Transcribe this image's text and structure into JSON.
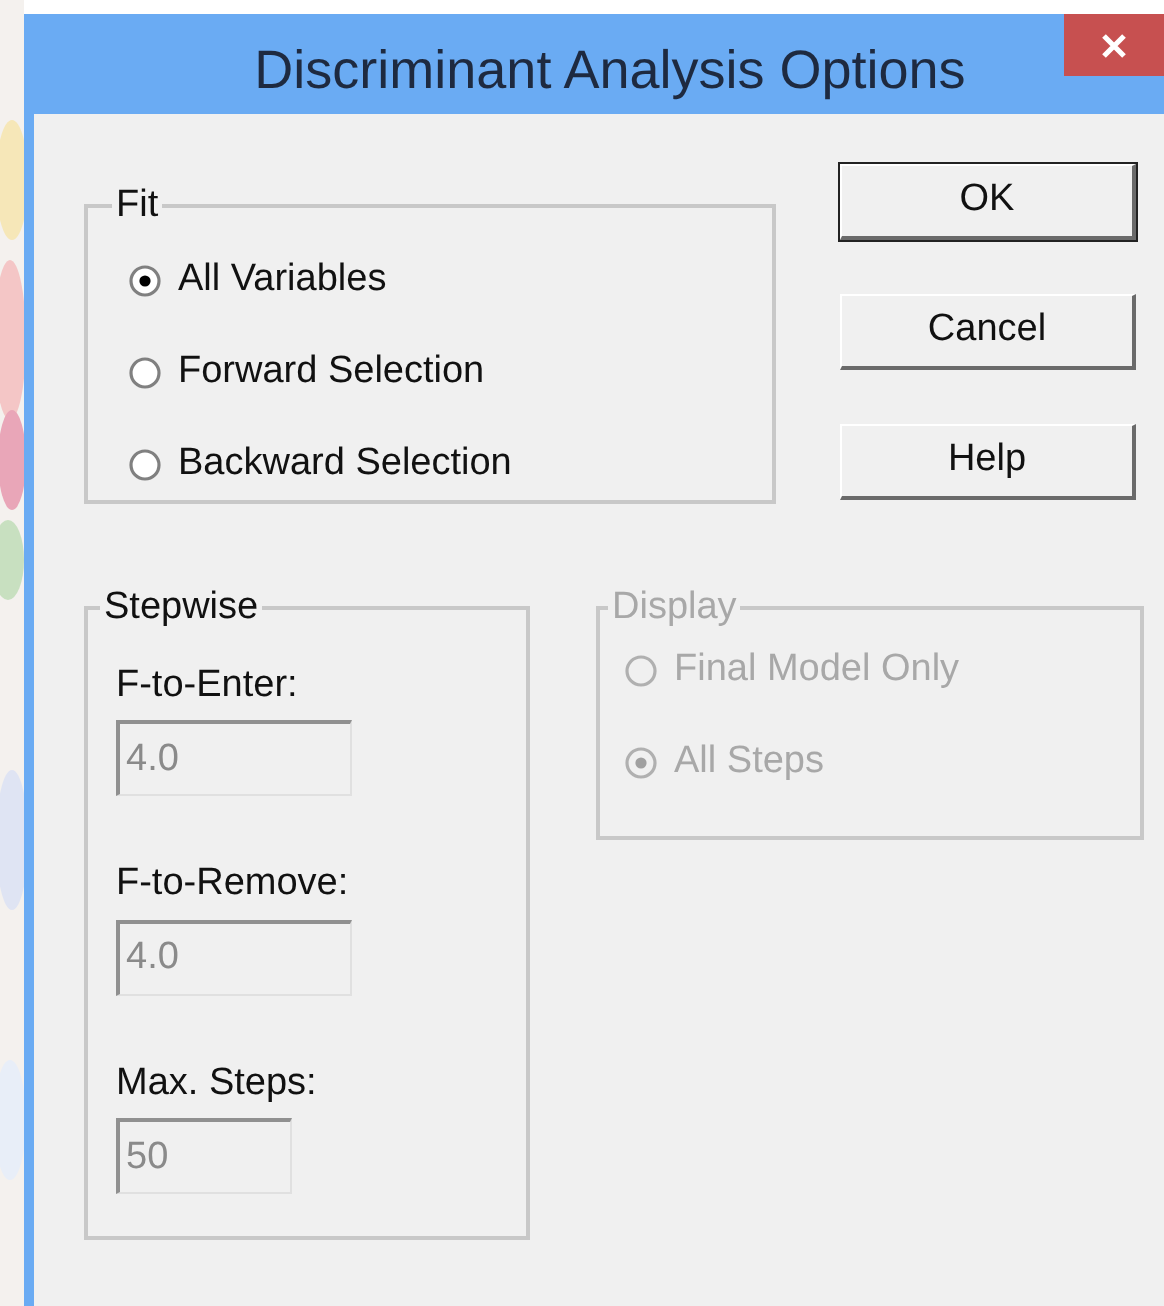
{
  "window": {
    "title": "Discriminant Analysis Options"
  },
  "fit": {
    "label": "Fit",
    "options": [
      {
        "label": "All Variables",
        "selected": true
      },
      {
        "label": "Forward Selection",
        "selected": false
      },
      {
        "label": "Backward Selection",
        "selected": false
      }
    ]
  },
  "buttons": [
    "OK",
    "Cancel",
    "Help"
  ],
  "stepwise": {
    "label": "Stepwise",
    "fields": [
      {
        "label": "F-to-Enter:",
        "value": "4.0",
        "disabled": true
      },
      {
        "label": "F-to-Remove:",
        "value": "4.0",
        "disabled": true
      },
      {
        "label": "Max. Steps:",
        "value": "50",
        "disabled": true
      }
    ]
  },
  "display": {
    "label": "Display",
    "disabled": true,
    "options": [
      {
        "label": "Final Model Only",
        "selected": false
      },
      {
        "label": "All Steps",
        "selected": true
      }
    ]
  }
}
